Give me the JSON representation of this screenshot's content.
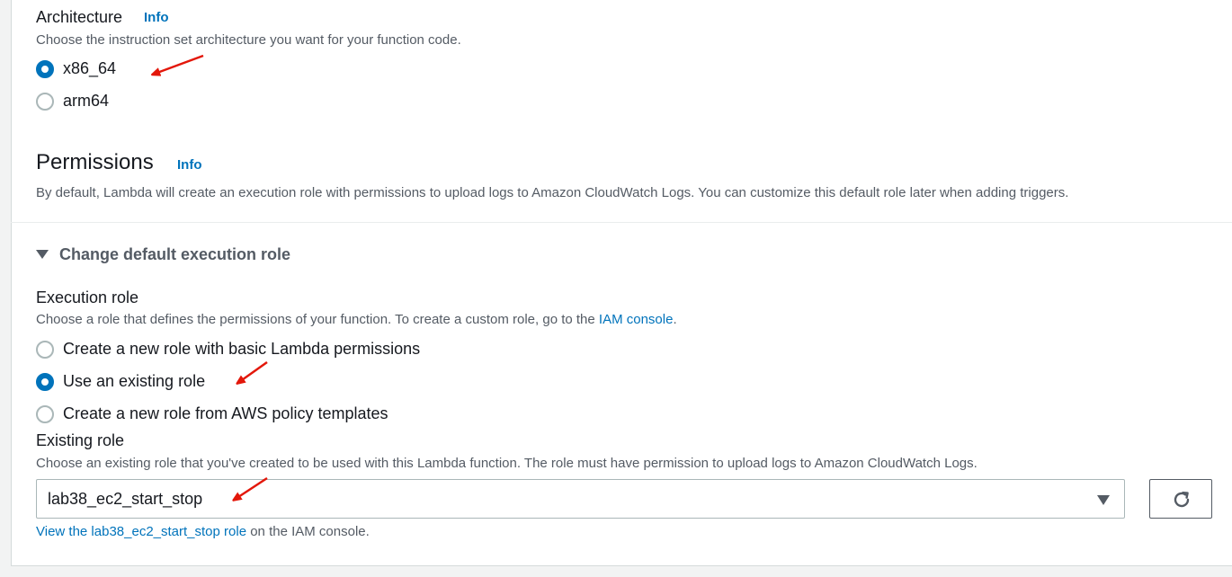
{
  "architecture": {
    "title": "Architecture",
    "info": "Info",
    "description": "Choose the instruction set architecture you want for your function code.",
    "options": [
      {
        "label": "x86_64",
        "selected": true
      },
      {
        "label": "arm64",
        "selected": false
      }
    ]
  },
  "permissions": {
    "title": "Permissions",
    "info": "Info",
    "description": "By default, Lambda will create an execution role with permissions to upload logs to Amazon CloudWatch Logs. You can customize this default role later when adding triggers."
  },
  "execution_role_section": {
    "expander_label": "Change default execution role",
    "expanded": true,
    "title": "Execution role",
    "description_prefix": "Choose a role that defines the permissions of your function. To create a custom role, go to the ",
    "description_link": "IAM console",
    "description_suffix": ".",
    "options": [
      {
        "label": "Create a new role with basic Lambda permissions",
        "selected": false
      },
      {
        "label": "Use an existing role",
        "selected": true
      },
      {
        "label": "Create a new role from AWS policy templates",
        "selected": false
      }
    ]
  },
  "existing_role": {
    "title": "Existing role",
    "description": "Choose an existing role that you've created to be used with this Lambda function. The role must have permission to upload logs to Amazon CloudWatch Logs.",
    "selected_value": "lab38_ec2_start_stop",
    "footer_link": "View the lab38_ec2_start_stop role",
    "footer_suffix": " on the IAM console."
  },
  "icons": {
    "refresh": "refresh-icon",
    "dropdown": "caret-down-icon",
    "expander": "caret-down-icon"
  },
  "colors": {
    "accent": "#0073bb",
    "annotation_arrow": "#e3170a"
  }
}
